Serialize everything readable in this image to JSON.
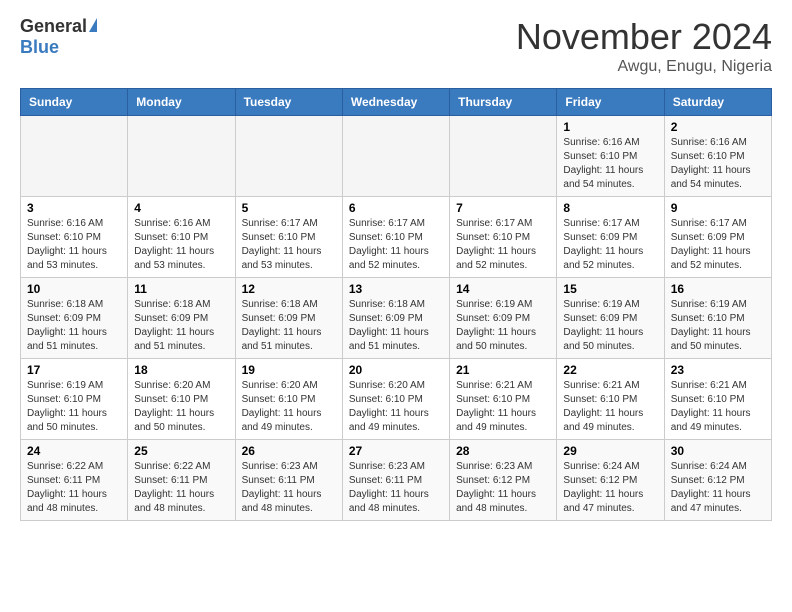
{
  "header": {
    "logo_general": "General",
    "logo_blue": "Blue",
    "title": "November 2024",
    "location": "Awgu, Enugu, Nigeria"
  },
  "days_of_week": [
    "Sunday",
    "Monday",
    "Tuesday",
    "Wednesday",
    "Thursday",
    "Friday",
    "Saturday"
  ],
  "weeks": [
    [
      {
        "day": "",
        "info": ""
      },
      {
        "day": "",
        "info": ""
      },
      {
        "day": "",
        "info": ""
      },
      {
        "day": "",
        "info": ""
      },
      {
        "day": "",
        "info": ""
      },
      {
        "day": "1",
        "info": "Sunrise: 6:16 AM\nSunset: 6:10 PM\nDaylight: 11 hours and 54 minutes."
      },
      {
        "day": "2",
        "info": "Sunrise: 6:16 AM\nSunset: 6:10 PM\nDaylight: 11 hours and 54 minutes."
      }
    ],
    [
      {
        "day": "3",
        "info": "Sunrise: 6:16 AM\nSunset: 6:10 PM\nDaylight: 11 hours and 53 minutes."
      },
      {
        "day": "4",
        "info": "Sunrise: 6:16 AM\nSunset: 6:10 PM\nDaylight: 11 hours and 53 minutes."
      },
      {
        "day": "5",
        "info": "Sunrise: 6:17 AM\nSunset: 6:10 PM\nDaylight: 11 hours and 53 minutes."
      },
      {
        "day": "6",
        "info": "Sunrise: 6:17 AM\nSunset: 6:10 PM\nDaylight: 11 hours and 52 minutes."
      },
      {
        "day": "7",
        "info": "Sunrise: 6:17 AM\nSunset: 6:10 PM\nDaylight: 11 hours and 52 minutes."
      },
      {
        "day": "8",
        "info": "Sunrise: 6:17 AM\nSunset: 6:09 PM\nDaylight: 11 hours and 52 minutes."
      },
      {
        "day": "9",
        "info": "Sunrise: 6:17 AM\nSunset: 6:09 PM\nDaylight: 11 hours and 52 minutes."
      }
    ],
    [
      {
        "day": "10",
        "info": "Sunrise: 6:18 AM\nSunset: 6:09 PM\nDaylight: 11 hours and 51 minutes."
      },
      {
        "day": "11",
        "info": "Sunrise: 6:18 AM\nSunset: 6:09 PM\nDaylight: 11 hours and 51 minutes."
      },
      {
        "day": "12",
        "info": "Sunrise: 6:18 AM\nSunset: 6:09 PM\nDaylight: 11 hours and 51 minutes."
      },
      {
        "day": "13",
        "info": "Sunrise: 6:18 AM\nSunset: 6:09 PM\nDaylight: 11 hours and 51 minutes."
      },
      {
        "day": "14",
        "info": "Sunrise: 6:19 AM\nSunset: 6:09 PM\nDaylight: 11 hours and 50 minutes."
      },
      {
        "day": "15",
        "info": "Sunrise: 6:19 AM\nSunset: 6:09 PM\nDaylight: 11 hours and 50 minutes."
      },
      {
        "day": "16",
        "info": "Sunrise: 6:19 AM\nSunset: 6:10 PM\nDaylight: 11 hours and 50 minutes."
      }
    ],
    [
      {
        "day": "17",
        "info": "Sunrise: 6:19 AM\nSunset: 6:10 PM\nDaylight: 11 hours and 50 minutes."
      },
      {
        "day": "18",
        "info": "Sunrise: 6:20 AM\nSunset: 6:10 PM\nDaylight: 11 hours and 50 minutes."
      },
      {
        "day": "19",
        "info": "Sunrise: 6:20 AM\nSunset: 6:10 PM\nDaylight: 11 hours and 49 minutes."
      },
      {
        "day": "20",
        "info": "Sunrise: 6:20 AM\nSunset: 6:10 PM\nDaylight: 11 hours and 49 minutes."
      },
      {
        "day": "21",
        "info": "Sunrise: 6:21 AM\nSunset: 6:10 PM\nDaylight: 11 hours and 49 minutes."
      },
      {
        "day": "22",
        "info": "Sunrise: 6:21 AM\nSunset: 6:10 PM\nDaylight: 11 hours and 49 minutes."
      },
      {
        "day": "23",
        "info": "Sunrise: 6:21 AM\nSunset: 6:10 PM\nDaylight: 11 hours and 49 minutes."
      }
    ],
    [
      {
        "day": "24",
        "info": "Sunrise: 6:22 AM\nSunset: 6:11 PM\nDaylight: 11 hours and 48 minutes."
      },
      {
        "day": "25",
        "info": "Sunrise: 6:22 AM\nSunset: 6:11 PM\nDaylight: 11 hours and 48 minutes."
      },
      {
        "day": "26",
        "info": "Sunrise: 6:23 AM\nSunset: 6:11 PM\nDaylight: 11 hours and 48 minutes."
      },
      {
        "day": "27",
        "info": "Sunrise: 6:23 AM\nSunset: 6:11 PM\nDaylight: 11 hours and 48 minutes."
      },
      {
        "day": "28",
        "info": "Sunrise: 6:23 AM\nSunset: 6:12 PM\nDaylight: 11 hours and 48 minutes."
      },
      {
        "day": "29",
        "info": "Sunrise: 6:24 AM\nSunset: 6:12 PM\nDaylight: 11 hours and 47 minutes."
      },
      {
        "day": "30",
        "info": "Sunrise: 6:24 AM\nSunset: 6:12 PM\nDaylight: 11 hours and 47 minutes."
      }
    ]
  ]
}
